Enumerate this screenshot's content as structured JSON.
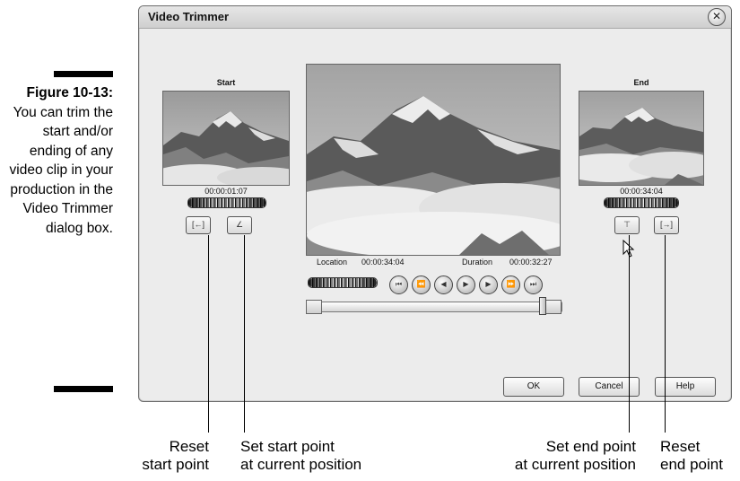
{
  "figure": {
    "label": "Figure 10-13:",
    "text": "You can trim the start and/or ending of any video clip in your production in the Video Trimmer dialog box."
  },
  "dialog": {
    "title": "Video Trimmer",
    "close_icon": "close-icon",
    "start_panel": {
      "title": "Start",
      "timecode": "00:00:01:07",
      "reset_button_icon": "reset-start-icon",
      "set_button_icon": "set-start-icon"
    },
    "end_panel": {
      "title": "End",
      "timecode": "00:00:34:04",
      "set_button_icon": "set-end-icon",
      "reset_button_icon": "reset-end-icon"
    },
    "preview": {
      "location_label": "Location",
      "location_value": "00:00:34:04",
      "duration_label": "Duration",
      "duration_value": "00:00:32:27"
    },
    "transport": [
      {
        "name": "go-to-start-icon",
        "glyph": "⏮"
      },
      {
        "name": "rewind-icon",
        "glyph": "⏪"
      },
      {
        "name": "step-back-icon",
        "glyph": "◀"
      },
      {
        "name": "play-icon",
        "glyph": "▶"
      },
      {
        "name": "step-forward-icon",
        "glyph": "▶"
      },
      {
        "name": "fast-forward-icon",
        "glyph": "⏩"
      },
      {
        "name": "go-to-end-icon",
        "glyph": "⏭"
      }
    ],
    "buttons": {
      "ok": "OK",
      "cancel": "Cancel",
      "help": "Help"
    }
  },
  "callouts": {
    "reset_start": [
      "Reset",
      "start point"
    ],
    "set_start": [
      "Set start point",
      "at current position"
    ],
    "set_end": [
      "Set end point",
      "at current position"
    ],
    "reset_end": [
      "Reset",
      "end point"
    ]
  }
}
